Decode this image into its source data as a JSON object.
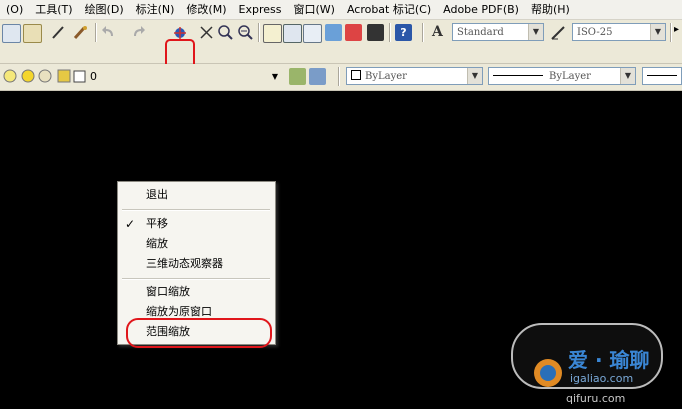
{
  "menubar": {
    "items": [
      "(O)",
      "工具(T)",
      "绘图(D)",
      "标注(N)",
      "修改(M)",
      "Express",
      "窗口(W)",
      "Acrobat 标记(C)",
      "Adobe PDF(B)",
      "帮助(H)"
    ]
  },
  "toolbar": {
    "text_style": "Standard",
    "dim_style": "ISO-25"
  },
  "layers": {
    "current_layer": "0",
    "color": "ByLayer",
    "linetype": "ByLayer"
  },
  "context_menu": {
    "items": [
      "退出",
      "平移",
      "缩放",
      "三维动态观察器",
      "窗口缩放",
      "缩放为原窗口",
      "范围缩放"
    ],
    "checked": "平移"
  },
  "watermark": {
    "line1": "爱 · 瑜聊",
    "line2": "igaliao.com",
    "line3": "qifuru.com"
  },
  "colors": {
    "highlight": "#e0161b",
    "canvas": "#000000",
    "menu_bg": "#f6f5f0"
  },
  "icons": [
    "pan-realtime-icon",
    "zoom-icon",
    "help-icon",
    "layer-icon",
    "text-style-icon",
    "dim-style-icon"
  ]
}
